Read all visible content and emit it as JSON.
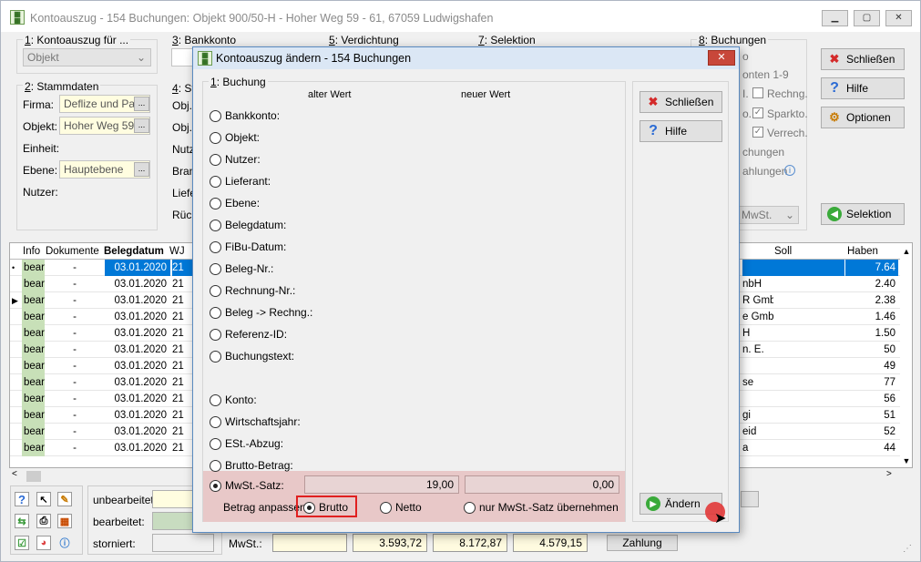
{
  "window": {
    "title": "Kontoauszug - 154 Buchungen:  Objekt 900/50-H - Hoher Weg 59 - 61, 67059 Ludwigshafen",
    "minimize": "▁",
    "maximize": "▢",
    "close": "✕"
  },
  "sections": {
    "s1": {
      "num": "1",
      "label": ": Kontoauszug für ...",
      "value": "Objekt"
    },
    "s2": {
      "num": "2",
      "label": ": Stammdaten",
      "firma_label": "Firma:",
      "firma_value": "Deflize und Part",
      "objekt_label": "Objekt:",
      "objekt_value": "Hoher Weg 59 -",
      "einheit_label": "Einheit:",
      "ebene_label": "Ebene:",
      "ebene_value": "Hauptebene",
      "nutzer_label": "Nutzer:"
    },
    "s3": {
      "num": "3",
      "label": ": Bankkonto"
    },
    "s4": {
      "num": "4",
      "label": ": St",
      "rows": [
        "Obj.-",
        "Obj.-",
        "Nutz",
        "Bran",
        "Liefe",
        "Rück"
      ]
    },
    "s5": {
      "num": "5",
      "label": ": Verdichtung"
    },
    "s7": {
      "num": "7",
      "label": ": Selektion"
    },
    "s8": {
      "num": "8",
      "label": ": Buchungen",
      "frag1": "o",
      "frag2": "onten 1-9",
      "frag3": "I.",
      "chk1": "Rechng.",
      "frag4": "o.",
      "chk2": "Sparkto.",
      "chk3": "Verrech.",
      "frag5": "chungen",
      "frag6": "ahlungen",
      "combo": "MwSt."
    }
  },
  "buttons": {
    "schliessen": "Schließen",
    "hilfe": "Hilfe",
    "optionen": "Optionen",
    "selektion": "Selektion",
    "zahlung": "Zahlung"
  },
  "grid": {
    "headers": [
      "Info",
      "Dokumente",
      "Belegdatum",
      "WJ"
    ],
    "right_headers": [
      "Soll",
      "Haben"
    ],
    "rows": [
      {
        "info": "bear",
        "dok": "-",
        "datum": "03.01.2020",
        "wj": "21",
        "name": "",
        "haben": "7.64"
      },
      {
        "info": "bear",
        "dok": "-",
        "datum": "03.01.2020",
        "wj": "21",
        "name": "nbH",
        "haben": "2.40"
      },
      {
        "info": "bear",
        "dok": "-",
        "datum": "03.01.2020",
        "wj": "21",
        "name": "R Gmbl",
        "haben": "2.38"
      },
      {
        "info": "bear",
        "dok": "-",
        "datum": "03.01.2020",
        "wj": "21",
        "name": "e Gmbh",
        "haben": "1.46"
      },
      {
        "info": "bear",
        "dok": "-",
        "datum": "03.01.2020",
        "wj": "21",
        "name": "H",
        "haben": "1.50"
      },
      {
        "info": "bear",
        "dok": "-",
        "datum": "03.01.2020",
        "wj": "21",
        "name": "n. E.",
        "haben": "50"
      },
      {
        "info": "bear",
        "dok": "-",
        "datum": "03.01.2020",
        "wj": "21",
        "name": "",
        "haben": "49"
      },
      {
        "info": "bear",
        "dok": "-",
        "datum": "03.01.2020",
        "wj": "21",
        "name": "se",
        "haben": "77"
      },
      {
        "info": "bear",
        "dok": "-",
        "datum": "03.01.2020",
        "wj": "21",
        "name": "",
        "haben": "56"
      },
      {
        "info": "bear",
        "dok": "-",
        "datum": "03.01.2020",
        "wj": "21",
        "name": "gi",
        "haben": "51"
      },
      {
        "info": "bear",
        "dok": "-",
        "datum": "03.01.2020",
        "wj": "21",
        "name": "eid",
        "haben": "52"
      },
      {
        "info": "bear",
        "dok": "-",
        "datum": "03.01.2020",
        "wj": "21",
        "name": "a",
        "haben": "44"
      }
    ]
  },
  "footer": {
    "unbearbeitet": "unbearbeitet:",
    "bearbeitet": "bearbeitet:",
    "storniert": "storniert:",
    "mwst": "MwSt.:",
    "v1": "3.593,72",
    "v2": "8.172,87",
    "v3": "4.579,15"
  },
  "dialog": {
    "title": "Kontoauszug ändern - 154 Buchungen",
    "group_num": "1",
    "group_label": ": Buchung",
    "col_alt": "alter Wert",
    "col_neu": "neuer Wert",
    "fields": [
      "Bankkonto:",
      "Objekt:",
      "Nutzer:",
      "Lieferant:",
      "Ebene:",
      "Belegdatum:",
      "FiBu-Datum:",
      "Beleg-Nr.:",
      "Rechnung-Nr.:",
      "Beleg -> Rechng.:",
      "Referenz-ID:",
      "Buchungstext:",
      "Konto:",
      "Wirtschaftsjahr:",
      "ESt.-Abzug:",
      "Brutto-Betrag:"
    ],
    "mwst_label": "MwSt.-Satz:",
    "mwst_alt": "19,00",
    "mwst_neu": "0,00",
    "betrag_label": "Betrag anpassen:",
    "opt_brutto": "Brutto",
    "opt_netto": "Netto",
    "opt_nur": "nur MwSt.-Satz übernehmen",
    "btn_schliessen": "Schließen",
    "btn_hilfe": "Hilfe",
    "btn_aendern": "Ändern"
  },
  "colors": {
    "selection": "#0078d7",
    "highlight": "#e8c8c8",
    "accent_red": "#e02020",
    "info_cell": "#c8e0b8"
  }
}
